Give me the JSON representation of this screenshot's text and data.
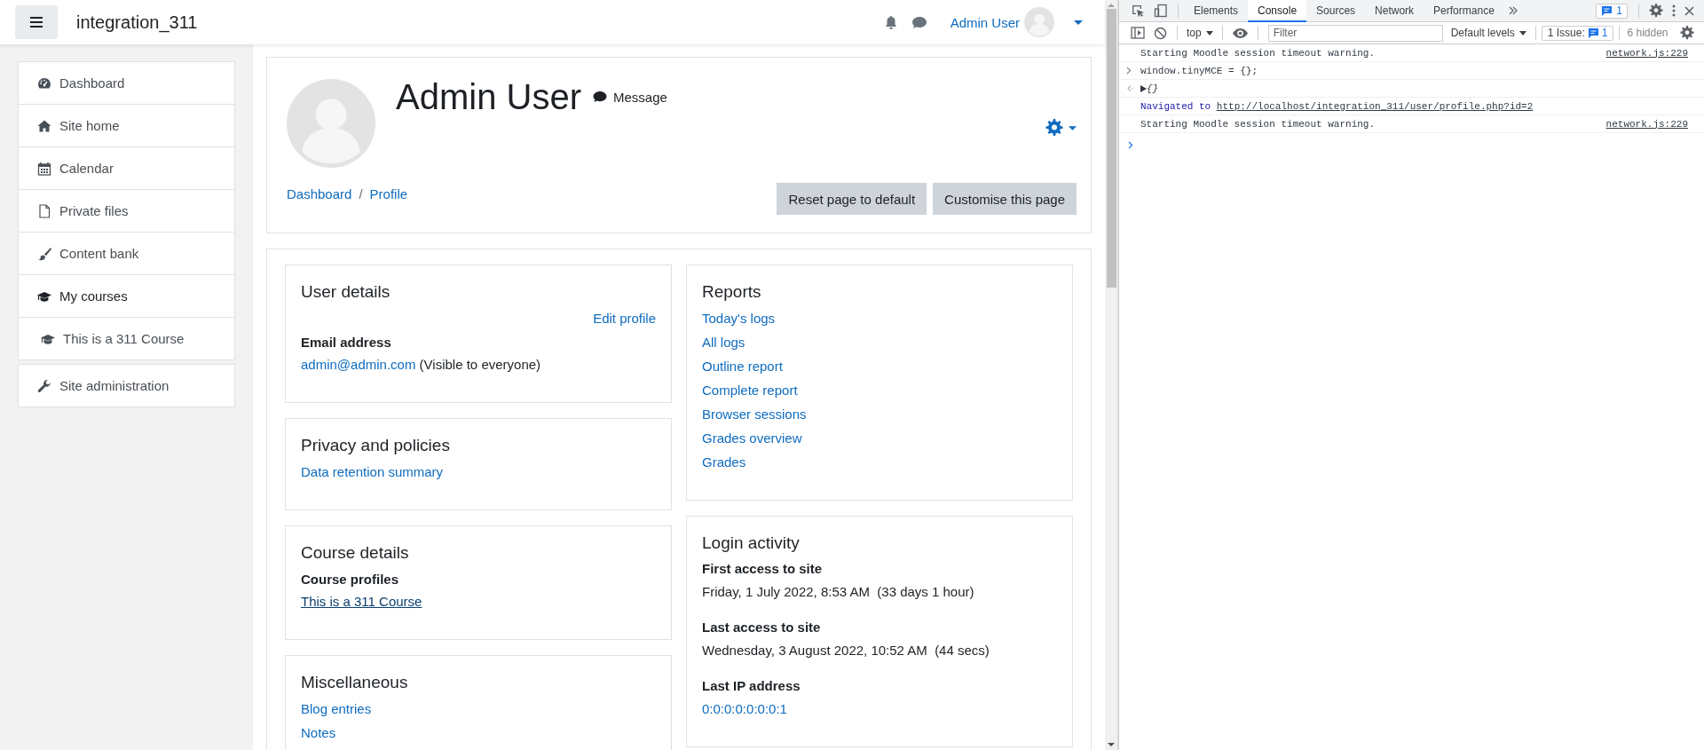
{
  "navbar": {
    "site_name": "integration_311",
    "user_name": "Admin User"
  },
  "sidebar": {
    "groups": [
      {
        "items": [
          {
            "kind": "link",
            "label": "Dashboard"
          },
          {
            "kind": "link",
            "label": "Site home"
          },
          {
            "kind": "link",
            "label": "Calendar"
          },
          {
            "kind": "link",
            "label": "Private files"
          },
          {
            "kind": "link",
            "label": "Content bank"
          },
          {
            "kind": "heading",
            "label": "My courses"
          },
          {
            "kind": "child",
            "label": "This is a 311 Course"
          }
        ]
      },
      {
        "items": [
          {
            "kind": "link",
            "label": "Site administration"
          }
        ]
      }
    ]
  },
  "profile_header": {
    "name": "Admin User",
    "message": "Message",
    "breadcrumb": {
      "items": [
        "Dashboard",
        "Profile"
      ],
      "separator": "/"
    },
    "buttons": [
      "Reset page to default",
      "Customise this page"
    ]
  },
  "columns": [
    {
      "sections": [
        {
          "title": "User details",
          "items": [
            {
              "kind": "action",
              "text": "Edit profile"
            },
            {
              "kind": "label",
              "text": "Email address"
            },
            {
              "kind": "link-note",
              "link": "admin@admin.com",
              "text": " (Visible to everyone)"
            }
          ]
        },
        {
          "title": "Privacy and policies",
          "items": [
            {
              "kind": "link",
              "text": "Data retention summary"
            }
          ]
        },
        {
          "title": "Course details",
          "items": [
            {
              "kind": "label",
              "text": "Course profiles"
            },
            {
              "kind": "hovered-link",
              "text": "This is a 311 Course"
            }
          ]
        },
        {
          "title": "Miscellaneous",
          "items": [
            {
              "kind": "link",
              "text": "Blog entries"
            },
            {
              "kind": "link",
              "text": "Notes"
            }
          ]
        }
      ]
    },
    {
      "sections": [
        {
          "title": "Reports",
          "items": [
            {
              "kind": "link",
              "text": "Today's logs"
            },
            {
              "kind": "link",
              "text": "All logs"
            },
            {
              "kind": "link",
              "text": "Outline report"
            },
            {
              "kind": "link",
              "text": "Complete report"
            },
            {
              "kind": "link",
              "text": "Browser sessions"
            },
            {
              "kind": "link",
              "text": "Grades overview"
            },
            {
              "kind": "link",
              "text": "Grades"
            }
          ]
        },
        {
          "title": "Login activity",
          "items": [
            {
              "kind": "label",
              "text": "First access to site"
            },
            {
              "kind": "text",
              "text": "Friday, 1 July 2022, 8:53 AM  (33 days 1 hour)"
            },
            {
              "kind": "label",
              "text": "Last access to site"
            },
            {
              "kind": "text",
              "text": "Wednesday, 3 August 2022, 10:52 AM  (44 secs)"
            },
            {
              "kind": "label",
              "text": "Last IP address"
            },
            {
              "kind": "link",
              "text": "0:0:0:0:0:0:0:1"
            }
          ]
        }
      ]
    }
  ],
  "devtools": {
    "tabs": [
      {
        "label": "Elements",
        "selected": false
      },
      {
        "label": "Console",
        "selected": true
      },
      {
        "label": "Sources",
        "selected": false
      },
      {
        "label": "Network",
        "selected": false
      },
      {
        "label": "Performance",
        "selected": false
      }
    ],
    "issue_badge": "1",
    "context": "top",
    "filter_placeholder": "Filter",
    "levels": "Default levels",
    "issues_label": "1 Issue:",
    "issues_count": "1",
    "hidden": "6 hidden",
    "console": [
      {
        "kind": "log",
        "text": "Starting Moodle session timeout warning.",
        "source": "network.js:229"
      },
      {
        "kind": "input",
        "text": "window.tinyMCE = {};"
      },
      {
        "kind": "result",
        "text": "{}"
      },
      {
        "kind": "navigation",
        "text": "Navigated to",
        "url": "http://localhost/integration_311/user/profile.php?id=2"
      },
      {
        "kind": "log",
        "text": "Starting Moodle session timeout warning.",
        "source": "network.js:229"
      }
    ]
  }
}
